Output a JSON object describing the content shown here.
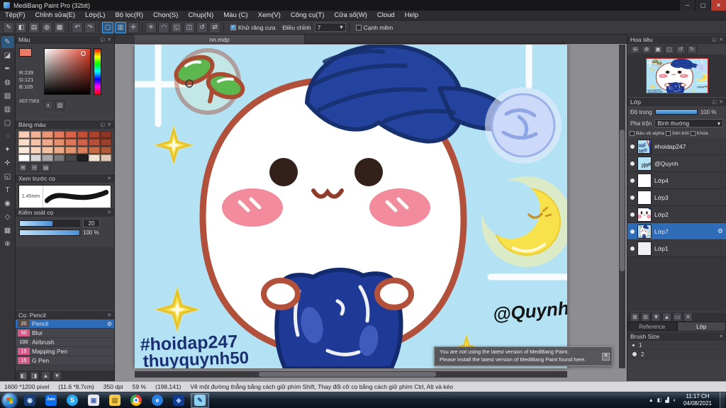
{
  "window": {
    "title": "MediBang Paint Pro (32bit)",
    "tab": "nn.mdp"
  },
  "menu": {
    "items": [
      "Tệp(F)",
      "Chỉnh sửa(E)",
      "Lớp(L)",
      "Bộ lọc(R)",
      "Chọn(S)",
      "Chụp(N)",
      "Màu (C)",
      "Xem(V)",
      "Công cụ(T)",
      "Cửa sổ(W)",
      "Cloud",
      "Help"
    ]
  },
  "toolbar": {
    "icons_a": [
      {
        "name": "brush-panel-icon",
        "glyph": "✎"
      },
      {
        "name": "dialog-icon",
        "glyph": "◧"
      },
      {
        "name": "material-panel-icon",
        "glyph": "▤"
      },
      {
        "name": "stamp-icon",
        "glyph": "◍"
      },
      {
        "name": "grid-icon",
        "glyph": "▩"
      }
    ],
    "undo_icons": [
      {
        "name": "undo-icon",
        "glyph": "↶"
      },
      {
        "name": "redo-icon",
        "glyph": "↷"
      }
    ],
    "select_icons": [
      {
        "name": "snap-off-icon",
        "glyph": "▢",
        "selected": true
      },
      {
        "name": "snap-parallel-icon",
        "glyph": "▥",
        "selected": true
      },
      {
        "name": "snap-cross-icon",
        "glyph": "✛",
        "selected": false
      }
    ],
    "icons_b": [
      {
        "name": "snap-radial-icon",
        "glyph": "✳"
      },
      {
        "name": "snap-curve-icon",
        "glyph": "◠"
      },
      {
        "name": "perspective-icon",
        "glyph": "◱"
      },
      {
        "name": "symmetry-icon",
        "glyph": "◫"
      },
      {
        "name": "rotate-canvas-icon",
        "glyph": "↺"
      },
      {
        "name": "flip-icon",
        "glyph": "⇄"
      }
    ],
    "antialias": "Khử răng cưa",
    "adjust_label": "Điều chỉnh",
    "adjust_value": "7",
    "soft_edge": "Cạnh mềm"
  },
  "tool_strip": [
    {
      "name": "brush-tool",
      "glyph": "✎",
      "selected": true
    },
    {
      "name": "eraser-tool",
      "glyph": "◪"
    },
    {
      "name": "pen-tool",
      "glyph": "✒"
    },
    {
      "name": "airbrush-tool",
      "glyph": "◍"
    },
    {
      "name": "bucket-fill-tool",
      "glyph": "▨"
    },
    {
      "name": "gradient-tool",
      "glyph": "▥"
    },
    {
      "name": "select-rect-tool",
      "glyph": "▢"
    },
    {
      "name": "lasso-tool",
      "glyph": "◌"
    },
    {
      "name": "magic-wand-tool",
      "glyph": "✦"
    },
    {
      "name": "move-tool",
      "glyph": "✛"
    },
    {
      "name": "transform-tool",
      "glyph": "◱"
    },
    {
      "name": "text-tool",
      "glyph": "T"
    },
    {
      "name": "eyedropper-tool",
      "glyph": "◉"
    },
    {
      "name": "hand-tool",
      "glyph": "◇"
    },
    {
      "name": "divide-tool",
      "glyph": "▦"
    },
    {
      "name": "zoom-tool",
      "glyph": "⊕"
    }
  ],
  "panels": {
    "color": {
      "title": "Màu",
      "r": "R:239",
      "g": "G:121",
      "b": "B:105",
      "hex": "#EF7969",
      "bottom_icons": [
        {
          "name": "color-wheel-icon",
          "glyph": "◐"
        },
        {
          "name": "color-bar-icon",
          "glyph": "▥"
        }
      ]
    },
    "palette": {
      "title": "Bảng màu",
      "swatches": [
        "#f8cdb4",
        "#f3b195",
        "#ec9478",
        "#e57a5e",
        "#d96147",
        "#c24e38",
        "#aa422e",
        "#8e3626",
        "#f9ddc8",
        "#f5c4a8",
        "#efa98a",
        "#e8906e",
        "#dd7758",
        "#cf6146",
        "#b95038",
        "#9c422c",
        "#fae8d8",
        "#f7d4bc",
        "#f2bfa0",
        "#ecab86",
        "#e4956e",
        "#d98058",
        "#c96c46",
        "#b05a38",
        "#ffffff",
        "#d8d8d8",
        "#a8a8a8",
        "#787878",
        "#484848",
        "#202020",
        "#f2e2d2",
        "#e0c8b4"
      ],
      "bottom_icons": [
        {
          "name": "add-color-icon",
          "glyph": "⊞"
        },
        {
          "name": "remove-color-icon",
          "glyph": "⊟"
        },
        {
          "name": "palette-menu-icon",
          "glyph": "▤"
        }
      ]
    },
    "brush_preview": {
      "title": "Xem trước cọ",
      "size_label": "1.45mm"
    },
    "brush_control": {
      "title": "Kiểm soát cọ",
      "size_value": "20",
      "opacity_value": "100 %"
    },
    "brush_list": {
      "title": "Cọ: Pencil",
      "brushes": [
        {
          "size": "20",
          "name": "Pencil",
          "chip": "#5b4a42",
          "selected": true
        },
        {
          "size": "50",
          "name": "Blur",
          "chip": "#d85a8a"
        },
        {
          "size": "100",
          "name": "Airbrush",
          "chip": "#4a4a52"
        },
        {
          "size": "15",
          "name": "Mapping Pen",
          "chip": "#d85a8a"
        },
        {
          "size": "15",
          "name": "G Pen",
          "chip": "#d85a8a"
        }
      ]
    },
    "left_bottom_icons": [
      {
        "name": "dock-left-icon",
        "glyph": "◧"
      },
      {
        "name": "dock-right-icon",
        "glyph": "◨"
      },
      {
        "name": "collapse-icon",
        "glyph": "▲"
      },
      {
        "name": "expand-icon",
        "glyph": "▼"
      }
    ],
    "navigator": {
      "title": "Hoa tiêu",
      "zoom_icons": [
        {
          "name": "zoom-out-icon",
          "glyph": "⊖"
        },
        {
          "name": "zoom-in-icon",
          "glyph": "⊕"
        },
        {
          "name": "zoom-fit-icon",
          "glyph": "▣"
        },
        {
          "name": "zoom-100-icon",
          "glyph": "◻"
        },
        {
          "name": "rotate-left-icon",
          "glyph": "↺"
        },
        {
          "name": "rotate-right-icon",
          "glyph": "↻"
        }
      ]
    },
    "layers": {
      "title": "Lớp",
      "opacity_label": "Độ trong",
      "opacity_value": "100 %",
      "blend_label": "Pha trộn",
      "blend_value": "Bình thường",
      "checks": [
        "Bảo vệ alpha",
        "Xén bớt",
        "Khóa"
      ],
      "items": [
        {
          "name": "#hoidap247",
          "thumb": "text"
        },
        {
          "name": "@Quynh",
          "thumb": "sig"
        },
        {
          "name": "Lớp4",
          "thumb": "white"
        },
        {
          "name": "Lớp3",
          "thumb": "white"
        },
        {
          "name": "Lớp2",
          "thumb": "face"
        },
        {
          "name": "Lớp7",
          "thumb": "art",
          "selected": true
        },
        {
          "name": "Lớp1",
          "thumb": "faint"
        }
      ],
      "bottom_icons": [
        {
          "name": "add-layer-icon",
          "glyph": "⊞"
        },
        {
          "name": "duplicate-layer-icon",
          "glyph": "⊟"
        },
        {
          "name": "merge-down-icon",
          "glyph": "▼"
        },
        {
          "name": "move-up-icon",
          "glyph": "▲"
        },
        {
          "name": "clear-layer-icon",
          "glyph": "▭"
        },
        {
          "name": "delete-layer-icon",
          "glyph": "✕"
        }
      ],
      "tabs": [
        {
          "label": "Reference",
          "active": false
        },
        {
          "label": "Lớp",
          "active": true
        }
      ]
    },
    "brush_size": {
      "title": "Brush Size",
      "sizes": [
        "1",
        "2"
      ]
    }
  },
  "canvas": {
    "hashtag": "#hoidap247",
    "username": "thuyquynh50",
    "signature": "@Quynh",
    "background_color": "#b3e2f4"
  },
  "notification": {
    "line1": "You are not using the latest version of MediBang Paint.",
    "line2": "Please install the latest version of MediBang Paint found here."
  },
  "status": {
    "segments": [
      "1600 *1200 pixel",
      "(11.6 *8.7cm)",
      "350 dpi",
      "59 %",
      "(198,141)",
      "Vẽ một đường thẳng bằng cách giữ phím Shift, Thay đổi cỡ cọ bằng cách giữ phím Ctrl, Alt và kéo"
    ]
  },
  "taskbar": {
    "apps": [
      {
        "name": "media-player-icon",
        "bg": "#1a3f7a",
        "glyph": "◉",
        "fg": "#cfe4ff"
      },
      {
        "name": "zalo-icon",
        "bg": "#0e6cf0",
        "glyph": "Zalo",
        "fg": "#ffffff",
        "small": true
      },
      {
        "name": "skype-icon",
        "bg": "#28a8ea",
        "glyph": "S",
        "fg": "#ffffff",
        "round": true
      },
      {
        "name": "photos-icon",
        "bg": "#e8e8ec",
        "glyph": "▣",
        "fg": "#4a6ab0"
      },
      {
        "name": "explorer-icon",
        "bg": "#f2c94c",
        "glyph": "▤",
        "fg": "#9a7418"
      },
      {
        "name": "chrome-icon",
        "chrome": true
      },
      {
        "name": "ie-icon",
        "bg": "#2a7de0",
        "glyph": "e",
        "fg": "#ffffff",
        "round": true
      },
      {
        "name": "app-dark-icon",
        "bg": "#123a8c",
        "glyph": "◆",
        "fg": "#9ec0ff"
      },
      {
        "name": "medibang-icon",
        "bg": "#8fd0f0",
        "glyph": "✎",
        "fg": "#1a4a7a",
        "active": true
      }
    ],
    "tray_icons": [
      {
        "name": "tray-expand-icon",
        "glyph": "▲"
      },
      {
        "name": "action-center-icon",
        "glyph": "◧"
      },
      {
        "name": "network-icon",
        "glyph": "▟"
      },
      {
        "name": "volume-icon",
        "glyph": "◖"
      }
    ],
    "time": "11:17 CH",
    "date": "04/08/2021"
  },
  "colors": {
    "accent": "#2e6cb8",
    "selected_color": "#EF7969",
    "canvas_blue": "#b3e2f4"
  }
}
